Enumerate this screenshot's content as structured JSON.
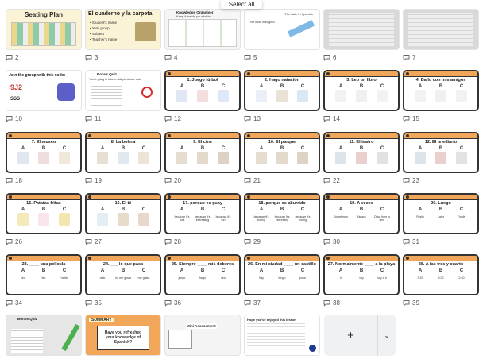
{
  "select_all_label": "Select all",
  "add_page_label": "+",
  "add_page_menu_label": "⌄",
  "pages": [
    {
      "num": "2",
      "type": "seating",
      "title": "Seating Plan"
    },
    {
      "num": "3",
      "type": "cuaderno",
      "title": "El cuaderno y la carpeta",
      "items": [
        "Student's name",
        "Year group",
        "Subject",
        "Teacher's name"
      ]
    },
    {
      "num": "4",
      "type": "doc",
      "title": "Knowledge Organiser",
      "subtitle": "Keep it inside your folder"
    },
    {
      "num": "5",
      "type": "notebook",
      "title": "The date in Spanish",
      "note": "The hook in English"
    },
    {
      "num": "6",
      "type": "photo"
    },
    {
      "num": "7",
      "type": "photo"
    },
    {
      "num": "10",
      "type": "join",
      "title": "Join the group with this code:",
      "code": "9J2",
      "sub": "SSS"
    },
    {
      "num": "11",
      "type": "bonus",
      "title": "Bonus Quiz",
      "line": "You're going to take a multiple choice quiz"
    },
    {
      "num": "12",
      "type": "quiz",
      "title": "1. Juego fútbol",
      "options": [
        {
          "letter": "A"
        },
        {
          "letter": "B"
        },
        {
          "letter": "C"
        }
      ],
      "colors": [
        "#e0e7f3",
        "#f3dede",
        "#dde9f7"
      ]
    },
    {
      "num": "13",
      "type": "quiz",
      "title": "2. Hago natación",
      "options": [
        {
          "letter": "A"
        },
        {
          "letter": "B"
        },
        {
          "letter": "C"
        }
      ],
      "colors": [
        "#e9eef8",
        "#e9e3d6",
        "#d8e9f5"
      ]
    },
    {
      "num": "14",
      "type": "quiz",
      "title": "3. Leo un libro",
      "options": [
        {
          "letter": "A"
        },
        {
          "letter": "B"
        },
        {
          "letter": "C"
        }
      ],
      "colors": [
        "#f2f2f2",
        "#f0f0f0",
        "#f2f2f2"
      ]
    },
    {
      "num": "15",
      "type": "quiz",
      "title": "4. Bailo con mis amigos",
      "options": [
        {
          "letter": "A"
        },
        {
          "letter": "B"
        },
        {
          "letter": "C"
        }
      ],
      "colors": [
        "#f2f2f2",
        "#f0f0f0",
        "#f2f2f2"
      ]
    },
    {
      "num": "18",
      "type": "quiz",
      "title": "7. El museo",
      "options": [
        {
          "letter": "A"
        },
        {
          "letter": "B"
        },
        {
          "letter": "C"
        }
      ],
      "colors": [
        "#dfe6ef",
        "#eedede",
        "#f0e8d8"
      ]
    },
    {
      "num": "19",
      "type": "quiz",
      "title": "8. La bolera",
      "options": [
        {
          "letter": "A"
        },
        {
          "letter": "B"
        },
        {
          "letter": "C"
        }
      ],
      "colors": [
        "#e6e0d4",
        "#e2e8f0",
        "#ece4d4"
      ]
    },
    {
      "num": "20",
      "type": "quiz",
      "title": "9. El cine",
      "options": [
        {
          "letter": "A"
        },
        {
          "letter": "B"
        },
        {
          "letter": "C"
        }
      ],
      "colors": [
        "#e6ddd0",
        "#e3dacb",
        "#ddd3c5"
      ]
    },
    {
      "num": "21",
      "type": "quiz",
      "title": "10. El parque",
      "options": [
        {
          "letter": "A"
        },
        {
          "letter": "B"
        },
        {
          "letter": "C"
        }
      ],
      "colors": [
        "#e6ddd0",
        "#e3dacb",
        "#ddd3c5"
      ]
    },
    {
      "num": "22",
      "type": "quiz",
      "title": "11. El teatro",
      "options": [
        {
          "letter": "A"
        },
        {
          "letter": "B"
        },
        {
          "letter": "C"
        }
      ],
      "colors": [
        "#dde4ea",
        "#e9d0cc",
        "#e2e2e2"
      ]
    },
    {
      "num": "23",
      "type": "quiz",
      "title": "12. El telediario",
      "options": [
        {
          "letter": "A"
        },
        {
          "letter": "B"
        },
        {
          "letter": "C"
        }
      ],
      "colors": [
        "#dde4ea",
        "#e9d0cc",
        "#e2e2e2"
      ]
    },
    {
      "num": "26",
      "type": "quiz",
      "title": "15. Patatas fritas",
      "options": [
        {
          "letter": "A"
        },
        {
          "letter": "B"
        },
        {
          "letter": "C"
        }
      ],
      "colors": [
        "#f4e9b8",
        "#f7e4ec",
        "#f3e7b0"
      ]
    },
    {
      "num": "27",
      "type": "quiz",
      "title": "16. El té",
      "options": [
        {
          "letter": "A"
        },
        {
          "letter": "B"
        },
        {
          "letter": "C"
        }
      ],
      "colors": [
        "#e3eef2",
        "#e7dccb",
        "#e9d7cd"
      ]
    },
    {
      "num": "28",
      "type": "quiz",
      "title": "17. porque es guay",
      "options": [
        {
          "letter": "A",
          "word": "because it's cool"
        },
        {
          "letter": "B",
          "word": "because it's interesting"
        },
        {
          "letter": "C",
          "word": "because it's fun"
        }
      ]
    },
    {
      "num": "29",
      "type": "quiz",
      "title": "18. porque es aburrido",
      "options": [
        {
          "letter": "A",
          "word": "because it's boring"
        },
        {
          "letter": "B",
          "word": "because it's interesting"
        },
        {
          "letter": "C",
          "word": "because it's boring"
        }
      ]
    },
    {
      "num": "30",
      "type": "quiz",
      "title": "19. A veces",
      "options": [
        {
          "letter": "A",
          "word": "Sometimes"
        },
        {
          "letter": "B",
          "word": "Always"
        },
        {
          "letter": "C",
          "word": "Once time to time"
        }
      ]
    },
    {
      "num": "31",
      "type": "quiz",
      "title": "20. Luego",
      "options": [
        {
          "letter": "A",
          "word": "Firstly"
        },
        {
          "letter": "B",
          "word": "Later"
        },
        {
          "letter": "C",
          "word": "Finally"
        }
      ]
    },
    {
      "num": "34",
      "type": "quiz",
      "title": "23. ____ una película",
      "options": [
        {
          "letter": "A",
          "word": "veo"
        },
        {
          "letter": "B",
          "word": "leo"
        },
        {
          "letter": "C",
          "word": "hablo"
        }
      ]
    },
    {
      "num": "35",
      "type": "quiz",
      "title": "24. ___ lo que pasa",
      "options": [
        {
          "letter": "A",
          "word": "odio"
        },
        {
          "letter": "B",
          "word": "no me gusta"
        },
        {
          "letter": "C",
          "word": "me gusta"
        }
      ]
    },
    {
      "num": "36",
      "type": "quiz",
      "title": "25. Siempre ____ mis deberes",
      "options": [
        {
          "letter": "A",
          "word": "juego"
        },
        {
          "letter": "B",
          "word": "hago"
        },
        {
          "letter": "C",
          "word": "veo"
        }
      ]
    },
    {
      "num": "37",
      "type": "quiz",
      "title": "26. En mi ciudad ____ un castillo",
      "options": [
        {
          "letter": "A",
          "word": "hay"
        },
        {
          "letter": "B",
          "word": "tengo"
        },
        {
          "letter": "C",
          "word": "pone"
        }
      ]
    },
    {
      "num": "38",
      "type": "quiz",
      "title": "27. Normalmente ____ a la playa",
      "options": [
        {
          "letter": "A",
          "word": "ir"
        },
        {
          "letter": "B",
          "word": "voy"
        },
        {
          "letter": "C",
          "word": "soy a ir"
        }
      ]
    },
    {
      "num": "39",
      "type": "quiz",
      "title": "28. A las tres y cuarto",
      "options": [
        {
          "letter": "A",
          "word": "3:15"
        },
        {
          "letter": "B",
          "word": "3:30"
        },
        {
          "letter": "C",
          "word": "2:30"
        }
      ]
    },
    {
      "num": "",
      "type": "bonus2",
      "title": "Bonus Quiz"
    },
    {
      "num": "",
      "type": "summary",
      "title": "SUMMARY",
      "text": "Have you refreshed your knowledge of Spanish?"
    },
    {
      "num": "",
      "type": "mini",
      "title": "Mini Assessment"
    },
    {
      "num": "",
      "type": "text",
      "title": "Hope you've enjoyed this lesson"
    }
  ]
}
